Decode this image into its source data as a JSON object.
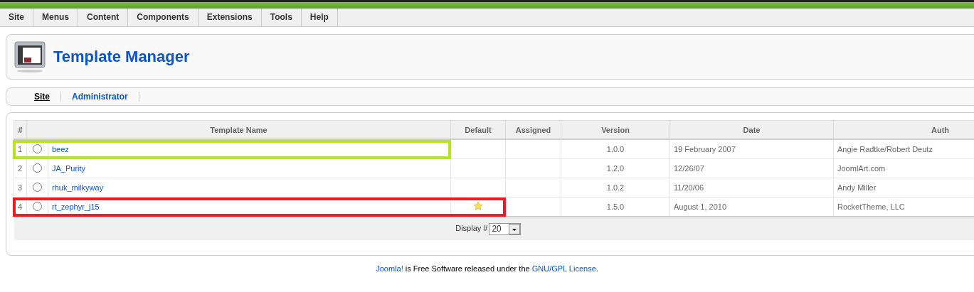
{
  "menu": [
    "Site",
    "Menus",
    "Content",
    "Components",
    "Extensions",
    "Tools",
    "Help"
  ],
  "page_title": "Template Manager",
  "tabs": [
    {
      "label": "Site",
      "selected": true
    },
    {
      "label": "Administrator",
      "selected": false
    }
  ],
  "table": {
    "columns": [
      "#",
      "Template Name",
      "Default",
      "Assigned",
      "Version",
      "Date",
      "Auth"
    ],
    "rows": [
      {
        "number": "1",
        "name": "beez",
        "selected": false,
        "default": false,
        "version": "1.0.0",
        "date": "19 February 2007",
        "column_7": "Angie Radtke/Robert Deutz",
        "outline": {
          "color": "#b5e61d",
          "kind": "name"
        }
      },
      {
        "number": "2",
        "name": "JA_Purity",
        "selected": false,
        "default": false,
        "version": "1.2.0",
        "date": "12/26/07",
        "column_7": "JoomlArt.com"
      },
      {
        "number": "3",
        "name": "rhuk_milkyway",
        "selected": false,
        "default": false,
        "version": "1.0.2",
        "date": "11/20/06",
        "column_7": "Andy Miller"
      },
      {
        "number": "4",
        "name": "rt_zephyr_j15",
        "selected": false,
        "default": true,
        "version": "1.5.0",
        "date": "August 1, 2010",
        "column_7": "RocketTheme, LLC",
        "outline": {
          "color": "#ed1c24",
          "kind": "default"
        }
      }
    ],
    "display_label": "Display #",
    "display_value": "20"
  },
  "footer": {
    "link1": "Joomla!",
    "text": " is Free Software released under the ",
    "link2": "GNU/GPL License",
    "end": "."
  }
}
